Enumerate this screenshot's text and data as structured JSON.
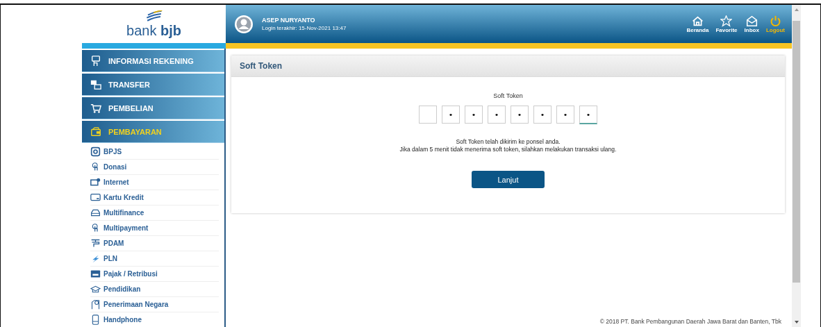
{
  "sidebar": {
    "logo": "bank **bjb**",
    "menu": [
      {
        "label": "INFORMASI REKENING",
        "selected": false
      },
      {
        "label": "TRANSFER",
        "selected": false
      },
      {
        "label": "PEMBELIAN",
        "selected": false
      },
      {
        "label": "PEMBAYARAN",
        "selected": true,
        "children": [
          {
            "label": "BPJS"
          },
          {
            "label": "Donasi"
          },
          {
            "label": "Internet"
          },
          {
            "label": "Kartu Kredit"
          },
          {
            "label": "Multifinance"
          },
          {
            "label": "Multipayment"
          },
          {
            "label": "PDAM"
          },
          {
            "label": "PLN"
          },
          {
            "label": "Pajak / Retribusi"
          },
          {
            "label": "Pendidikan"
          },
          {
            "label": "Penerimaan Negara"
          },
          {
            "label": "Handphone"
          }
        ]
      }
    ]
  },
  "header": {
    "user_name": "ASEP NURYANTO",
    "last_login": "Login terakhir: 15-Nov-2021 13:47",
    "nav": [
      {
        "label": "Beranda",
        "kind": "normal"
      },
      {
        "label": "Favorite",
        "kind": "normal"
      },
      {
        "label": "Inbox",
        "kind": "normal"
      },
      {
        "label": "Logout",
        "kind": "logout"
      }
    ]
  },
  "panel": {
    "title": "Soft Token",
    "field_label": "Soft Token",
    "token_fields": [
      {
        "focused": false
      },
      {
        "value": "•",
        "focused": false
      },
      {
        "value": "•",
        "focused": false
      },
      {
        "value": "•",
        "focused": false
      },
      {
        "value": "•",
        "focused": false
      },
      {
        "value": "•",
        "focused": false
      },
      {
        "value": "•",
        "focused": false
      },
      {
        "value": "•",
        "focused": true
      }
    ],
    "message_lines": [
      "Soft Token telah dikirim ke ponsel anda.",
      "Jika dalam 5 menit tidak menerima soft token, silahkan melakukan transaksi ulang."
    ],
    "button": "Lanjut"
  },
  "footer": "© 2018 PT. Bank Pembangunan Daerah Jawa Barat dan Banten, Tbk"
}
